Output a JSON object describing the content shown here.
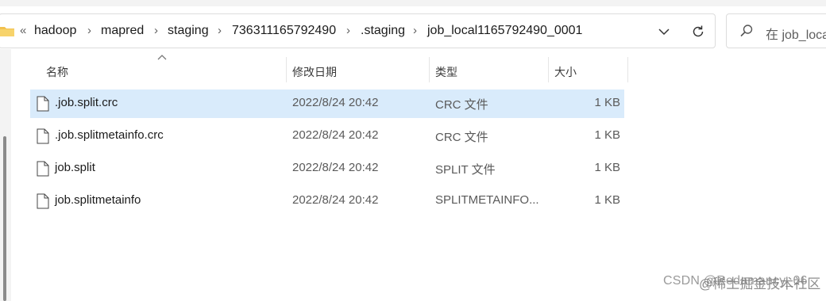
{
  "address_bar": {
    "overflow_glyph": "«",
    "separator": "›",
    "crumbs": [
      "hadoop",
      "mapred",
      "staging",
      "736311165792490",
      ".staging",
      "job_local1165792490_0001"
    ],
    "dropdown_icon": "chevron-down-icon",
    "refresh_icon": "refresh-icon"
  },
  "search": {
    "placeholder": "在 job_loca"
  },
  "columns": {
    "name": "名称",
    "date": "修改日期",
    "type": "类型",
    "size": "大小"
  },
  "files": [
    {
      "name": ".job.split.crc",
      "date": "2022/8/24 20:42",
      "type": "CRC 文件",
      "size": "1 KB",
      "selected": true
    },
    {
      "name": ".job.splitmetainfo.crc",
      "date": "2022/8/24 20:42",
      "type": "CRC 文件",
      "size": "1 KB",
      "selected": false
    },
    {
      "name": "job.split",
      "date": "2022/8/24 20:42",
      "type": "SPLIT 文件",
      "size": "1 KB",
      "selected": false
    },
    {
      "name": "job.splitmetainfo",
      "date": "2022/8/24 20:42",
      "type": "SPLITMETAINFO...",
      "size": "1 KB",
      "selected": false
    }
  ],
  "watermark": {
    "csdn": "CSDN @Redamancy_06",
    "juejin": "@稀土掘金技术社区"
  },
  "colors": {
    "selected_row": "#d9ebfb",
    "border": "#dcdcdc",
    "folder": "#f2c14e"
  }
}
